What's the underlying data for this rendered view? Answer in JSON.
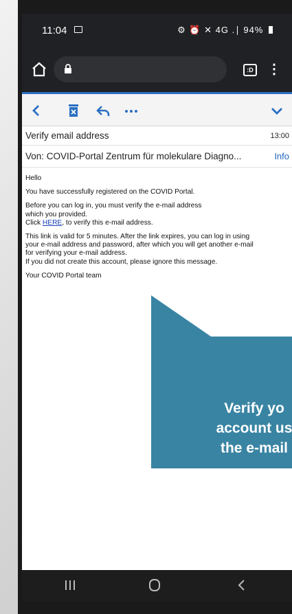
{
  "status_bar": {
    "time": "11:04",
    "right_icons_text": "⚙ ⏰ ✕ 4G .∣",
    "battery": "94%"
  },
  "browser": {
    "url": "",
    "tab_count_label": ":D"
  },
  "mail": {
    "subject": "Verify email address",
    "time": "13:00",
    "from_label": "Von:",
    "from_value": "COVID-Portal Zentrum für molekulare Diagno...",
    "info_label": "Info",
    "body": {
      "greeting": "Hello",
      "p1": "You have successfully registered on the COVID Portal.",
      "p2_line1": "Before you can log in, you must verify the e-mail address",
      "p2_line2": "which you provided.",
      "p2_click": "Click",
      "p2_link": "HERE",
      "p2_after": ", to verify this e-mail address.",
      "p3_line1": "This link is valid for 5 minutes. After the link expires, you can log in using",
      "p3_line2": "your e-mail address and password, after which you will get another e-mail",
      "p3_line3": "for verifying your e-mail address.",
      "p3_line4": "If you did not create this account, please ignore this message.",
      "signature": "Your COVID Portal team"
    }
  },
  "callout": {
    "line1": "Verify yo",
    "line2": "account us",
    "line3": "the e-mail",
    "color": "#3a84a3"
  },
  "colors": {
    "accent": "#2a70c3",
    "link": "#1a3fb5",
    "dark_bar": "#202124"
  }
}
